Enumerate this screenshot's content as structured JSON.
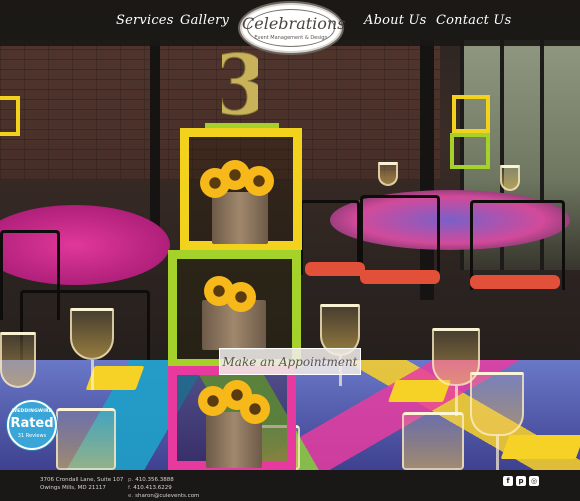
{
  "nav": {
    "left": [
      {
        "label": "Services"
      },
      {
        "label": "Gallery"
      }
    ],
    "right": [
      {
        "label": "About Us"
      },
      {
        "label": "Contact Us"
      }
    ]
  },
  "logo": {
    "name": "Celebrations",
    "tagline": "Event Management & Design"
  },
  "hero": {
    "table_number": "3"
  },
  "cta": {
    "label": "Make an Appointment"
  },
  "badge": {
    "top": "WEDDINGWIRE",
    "main": "Rated",
    "sub": "31 Reviews",
    "color": "#3aa6d8"
  },
  "footer": {
    "address_line1": "3706 Crondall Lane, Suite 107",
    "address_line2": "Owings Mills, MD 21117",
    "phone_prefix": "p.",
    "phone": "410.356.3888",
    "fax_prefix": "f.",
    "fax": "410.413.6229",
    "email_prefix": "e.",
    "email": "sharon@cuievents.com",
    "social": [
      {
        "icon": "facebook-icon",
        "glyph": "f"
      },
      {
        "icon": "pinterest-icon",
        "glyph": "p"
      },
      {
        "icon": "instagram-icon",
        "glyph": "◎"
      }
    ]
  },
  "colors": {
    "header_bg": "#1a1816",
    "accent_yellow": "#f2d21c",
    "accent_green": "#a4d22a",
    "accent_pink": "#e83a9e"
  }
}
